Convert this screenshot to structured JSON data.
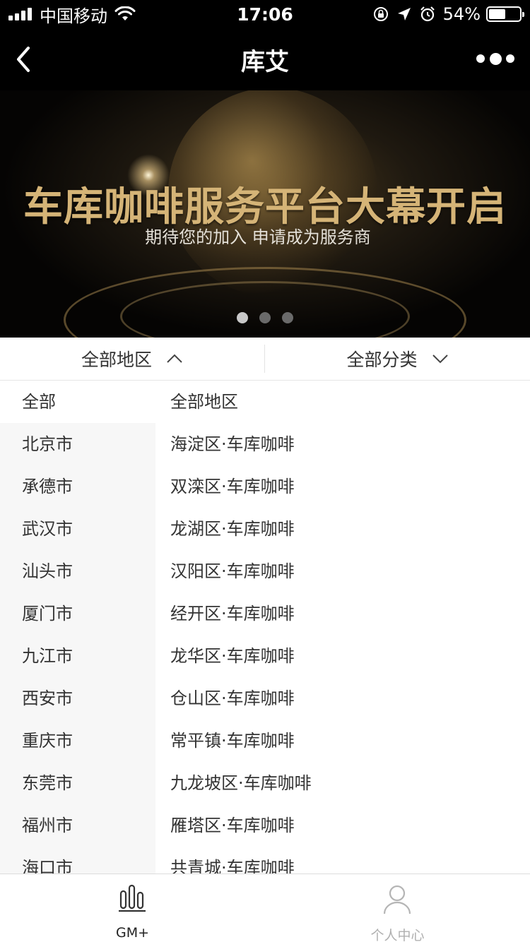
{
  "status_bar": {
    "carrier": "中国移动",
    "time": "17:06",
    "battery_percent": "54%",
    "battery_level": 0.54,
    "icons": [
      "signal-icon",
      "wifi-icon",
      "orientation-lock-icon",
      "location-icon",
      "alarm-icon",
      "battery-icon"
    ]
  },
  "nav": {
    "title": "库艾",
    "icons": [
      "back-arrow-icon",
      "more-dots-icon"
    ]
  },
  "banner": {
    "title": "车库咖啡服务平台大幕开启",
    "subtitle": "期待您的加入 申请成为服务商",
    "slide_count": 3,
    "active_slide": 1,
    "accent_color": "#d5b477"
  },
  "filters": {
    "region_label": "全部地区",
    "category_label": "全部分类",
    "region_state": "expanded",
    "icons": [
      "chevron-up-icon",
      "chevron-down-icon"
    ]
  },
  "region_panel": {
    "provinces": [
      "全部",
      "北京市",
      "承德市",
      "武汉市",
      "汕头市",
      "厦门市",
      "九江市",
      "西安市",
      "重庆市",
      "东莞市",
      "福州市",
      "海口市"
    ],
    "selected_province": "全部",
    "districts": [
      "全部地区",
      "海淀区·车库咖啡",
      "双滦区·车库咖啡",
      "龙湖区·车库咖啡",
      "汉阳区·车库咖啡",
      "经开区·车库咖啡",
      "龙华区·车库咖啡",
      "仓山区·车库咖啡",
      "常平镇·车库咖啡",
      "九龙坡区·车库咖啡",
      "雁塔区·车库咖啡",
      "共青城·车库咖啡"
    ]
  },
  "tab_bar": {
    "tabs": [
      {
        "label": "GM+",
        "icon": "gm-chart-icon",
        "active": true
      },
      {
        "label": "个人中心",
        "icon": "person-icon",
        "active": false
      }
    ]
  }
}
